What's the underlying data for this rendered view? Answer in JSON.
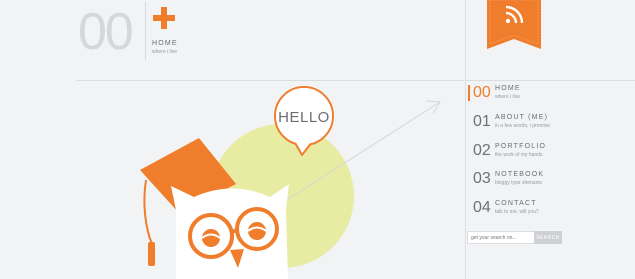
{
  "header": {
    "number": "00",
    "title": "HOME",
    "subtitle": "where i live"
  },
  "hero": {
    "speech_bubble": "HELLO"
  },
  "nav": {
    "items": [
      {
        "number": "00",
        "label": "HOME",
        "sub": "where i live",
        "active": true
      },
      {
        "number": "01",
        "label": "ABOUT (ME)",
        "sub": "in a few words, i promise",
        "active": false
      },
      {
        "number": "02",
        "label": "PORTFOLIO",
        "sub": "the work of my hands",
        "active": false
      },
      {
        "number": "03",
        "label": "NOTEBOOK",
        "sub": "bloggy type shenanis",
        "active": false
      },
      {
        "number": "04",
        "label": "CONTACT",
        "sub": "talk to me, will you?",
        "active": false
      }
    ]
  },
  "search": {
    "placeholder": "get your search on...",
    "button_label": "SEARCH"
  },
  "icons": {
    "rss": "rss-icon",
    "plus": "plus-icon"
  },
  "colors": {
    "accent": "#f07d2c",
    "circle": "#e8eba2",
    "background": "#f2f3f5"
  }
}
